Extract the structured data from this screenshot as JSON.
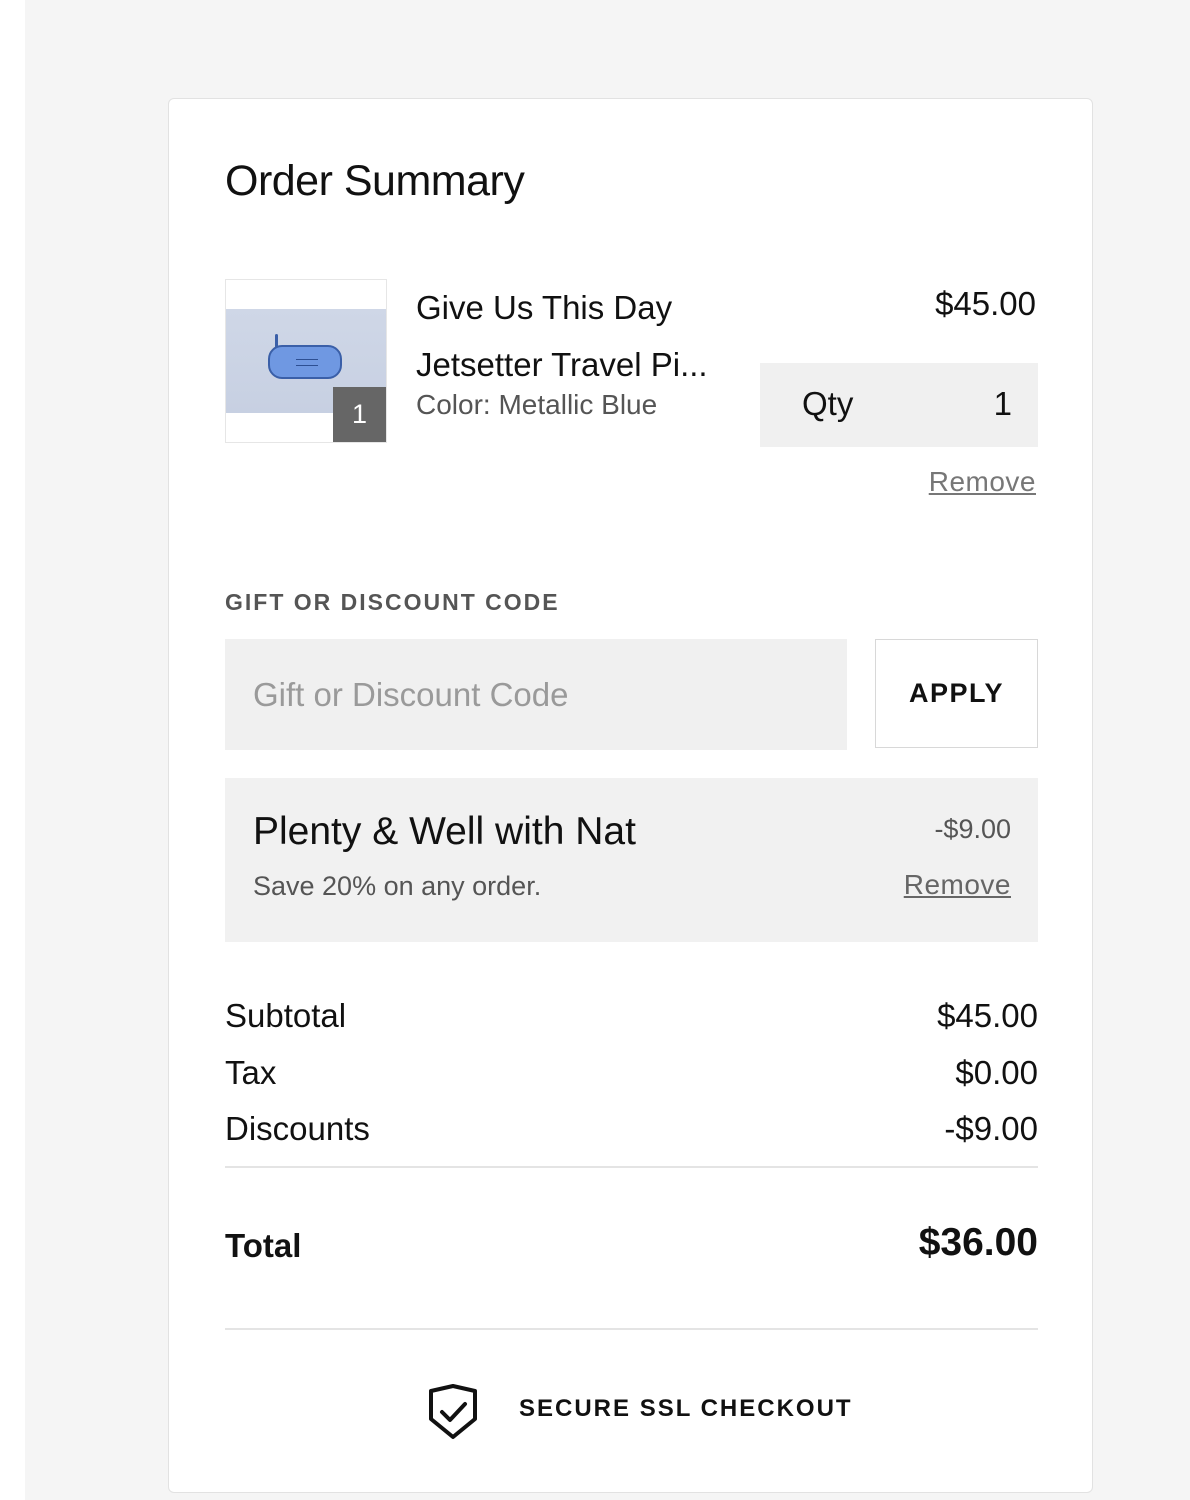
{
  "order_summary": {
    "title": "Order Summary"
  },
  "item": {
    "name_line1": "Give Us This Day",
    "name_line2": "Jetsetter Travel Pi...",
    "color": "Color: Metallic Blue",
    "price": "$45.00",
    "badge_count": "1",
    "qty_label": "Qty",
    "qty_value": "1",
    "remove_label": "Remove"
  },
  "discount_code": {
    "section_label": "GIFT OR DISCOUNT CODE",
    "placeholder": "Gift or Discount Code",
    "value": "",
    "apply_label": "APPLY"
  },
  "applied_discount": {
    "name": "Plenty & Well with Nat",
    "description": "Save 20% on any order.",
    "amount": "-$9.00",
    "remove_label": "Remove"
  },
  "totals": {
    "subtotal_label": "Subtotal",
    "subtotal_value": "$45.00",
    "tax_label": "Tax",
    "tax_value": "$0.00",
    "discounts_label": "Discounts",
    "discounts_value": "-$9.00",
    "total_label": "Total",
    "total_value": "$36.00"
  },
  "secure": {
    "text": "SECURE SSL CHECKOUT",
    "icon": "shield-check-icon"
  },
  "colors": {
    "page_background": "#f5f5f5",
    "card_background": "#ffffff",
    "field_background": "#f0f0f0",
    "product_blue": "#6f98e2"
  }
}
